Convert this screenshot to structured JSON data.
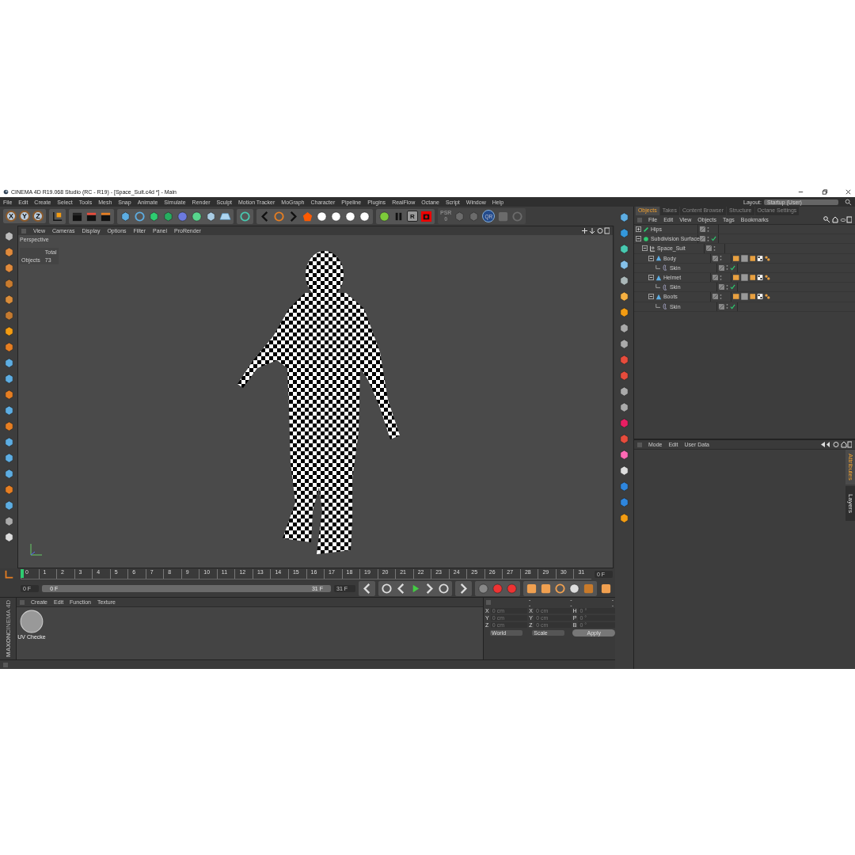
{
  "window": {
    "title": "CINEMA 4D R19.068 Studio (RC - R19) - [Space_Suit.c4d *] - Main"
  },
  "menu": [
    "File",
    "Edit",
    "Create",
    "Select",
    "Tools",
    "Mesh",
    "Snap",
    "Animate",
    "Simulate",
    "Render",
    "Sculpt",
    "Motion Tracker",
    "MoGraph",
    "Character",
    "Pipeline",
    "Plugins",
    "RealFlow",
    "Octane",
    "Script",
    "Window",
    "Help"
  ],
  "layout": {
    "label": "Layout:",
    "value": "Startup (User)"
  },
  "toolbar": {
    "axis_buttons": [
      "X",
      "Y",
      "Z"
    ],
    "render_region_label": "R",
    "psr_label": "PSR",
    "psr_value": "0",
    "qr_label": "QR"
  },
  "viewport": {
    "menu": [
      "View",
      "Cameras",
      "Display",
      "Options",
      "Filter",
      "Panel",
      "ProRender"
    ],
    "camera": "Perspective",
    "stats_header": "Total",
    "stats_label": "Objects",
    "stats_value": "73"
  },
  "timeline": {
    "ruler": [
      "0",
      "1",
      "2",
      "3",
      "4",
      "5",
      "6",
      "7",
      "8",
      "9",
      "10",
      "11",
      "12",
      "13",
      "14",
      "15",
      "16",
      "17",
      "18",
      "19",
      "20",
      "21",
      "22",
      "23",
      "24",
      "25",
      "26",
      "27",
      "28",
      "29",
      "30",
      "31"
    ],
    "playhead": {
      "level": 0
    },
    "range": {
      "level": 1
    },
    "current_frame": "0 F",
    "start_field": "0 F",
    "range_start": "0 F",
    "range_end": "31 F",
    "end_field": "31 F"
  },
  "materials": {
    "menu": [
      "Create",
      "Edit",
      "Function",
      "Texture"
    ],
    "items": [
      {
        "name": "UV Checke"
      }
    ]
  },
  "logo": {
    "brand": "MAXON",
    "product": "CINEMA 4D"
  },
  "coordinates": {
    "headers": [
      "--",
      "--",
      "--"
    ],
    "rows": [
      [
        {
          "axis": "X",
          "value": "0 cm"
        },
        {
          "axis": "X",
          "value": "0 cm"
        },
        {
          "axis": "H",
          "value": "0 °"
        }
      ],
      [
        {
          "axis": "Y",
          "value": "0 cm"
        },
        {
          "axis": "Y",
          "value": "0 cm"
        },
        {
          "axis": "P",
          "value": "0 °"
        }
      ],
      [
        {
          "axis": "Z",
          "value": "0 cm"
        },
        {
          "axis": "Z",
          "value": "0 cm"
        },
        {
          "axis": "B",
          "value": "0 °"
        }
      ]
    ],
    "dropdowns": [
      "World",
      "Scale"
    ],
    "apply": "Apply"
  },
  "objects": {
    "tabs": [
      {
        "label": "Objects",
        "selected": true
      },
      {
        "label": "Takes",
        "selected": false
      },
      {
        "label": "Content Browser",
        "selected": false
      },
      {
        "label": "Structure",
        "selected": false
      },
      {
        "label": "Octane Settings",
        "selected": false
      }
    ],
    "menu": [
      "File",
      "Edit",
      "View",
      "Objects",
      "Tags",
      "Bookmarks"
    ],
    "tree": [
      {
        "name": "Hips",
        "kind": "bone",
        "expanded": false,
        "enabled": false,
        "tagged": false
      },
      {
        "name": "Subdivision Surface",
        "kind": "subdivision",
        "expanded": true,
        "enabled": true,
        "tagged": false,
        "children": [
          {
            "name": "Space_Suit",
            "kind": "null",
            "expanded": true,
            "enabled": false,
            "tagged": false,
            "children": [
              {
                "name": "Body",
                "kind": "polygon",
                "expanded": true,
                "enabled": false,
                "tagged": true,
                "children": [
                  {
                    "name": "Skin",
                    "kind": "skin",
                    "enabled": true,
                    "tagged": false
                  }
                ]
              },
              {
                "name": "Helmet",
                "kind": "polygon",
                "expanded": true,
                "enabled": false,
                "tagged": true,
                "children": [
                  {
                    "name": "Skin",
                    "kind": "skin",
                    "enabled": true,
                    "tagged": false
                  }
                ]
              },
              {
                "name": "Boots",
                "kind": "polygon",
                "expanded": true,
                "enabled": false,
                "tagged": true,
                "children": [
                  {
                    "name": "Skin",
                    "kind": "skin",
                    "enabled": true,
                    "tagged": false
                  }
                ]
              }
            ]
          }
        ]
      }
    ]
  },
  "attributes": {
    "menu": [
      "Mode",
      "Edit",
      "User Data"
    ]
  },
  "side_tabs": [
    {
      "label": "Attributes",
      "selected": true
    },
    {
      "label": "Layers",
      "selected": false
    }
  ]
}
